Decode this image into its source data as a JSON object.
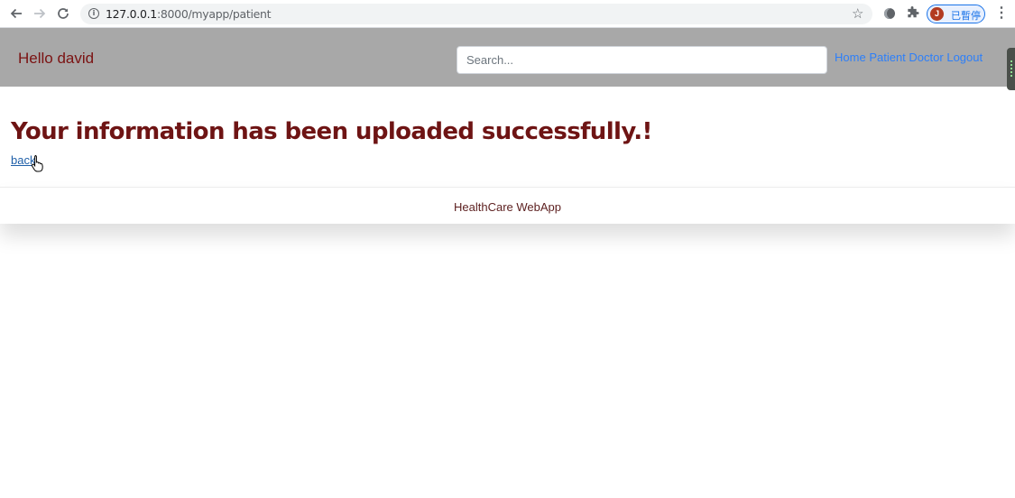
{
  "browser": {
    "url_host": "127.0.0.1",
    "url_rest": ":8000/myapp/patient",
    "profile_initial": "J",
    "profile_label": "已暫停"
  },
  "navbar": {
    "greeting": "Hello david",
    "search": {
      "placeholder": "Search...",
      "value": ""
    },
    "links": [
      "Home",
      "Patient",
      "Doctor",
      "Logout"
    ],
    "background": "#a8a8a8",
    "link_color": "#2d7ff9"
  },
  "main": {
    "heading": "Your information has been uploaded successfully.!",
    "back_link": "back",
    "heading_color": "#6e1414"
  },
  "footer": {
    "text": "HealthCare WebApp"
  },
  "icons": [
    "arrow-left-icon",
    "arrow-right-icon",
    "reload-icon",
    "info-icon",
    "star-icon",
    "extension-icon",
    "puzzle-icon",
    "kebab-menu-icon",
    "hand-cursor-icon"
  ]
}
